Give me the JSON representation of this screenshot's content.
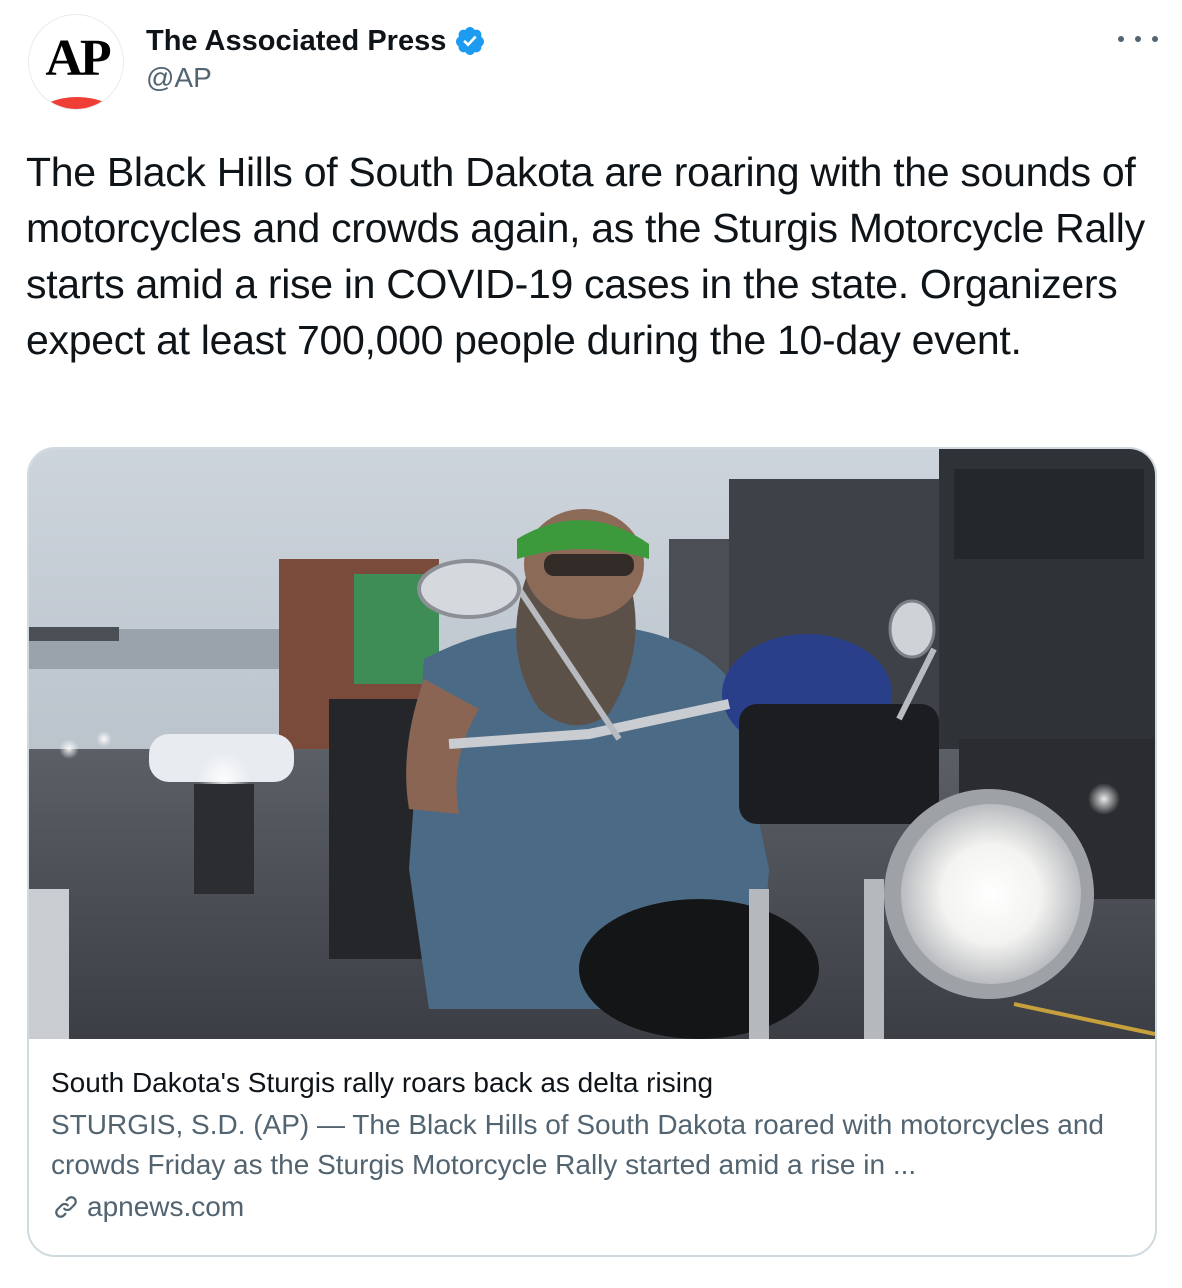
{
  "author": {
    "display_name": "The Associated Press",
    "handle": "@AP",
    "avatar_text": "AP",
    "verified": true
  },
  "more_icon": "more-horizontal-icon",
  "tweet": {
    "text": "The Black Hills of South Dakota are roaring with the sounds of motorcycles and crowds again, as the Sturgis Motorcycle Rally starts amid a rise in COVID-19 cases in the state. Organizers expect at least 700,000 people during the 10-day event."
  },
  "card": {
    "title": "South Dakota's Sturgis rally roars back as delta rising",
    "description": "STURGIS, S.D. (AP) — The Black Hills of South Dakota roared with motorcycles and crowds Friday as the Sturgis Motorcycle Rally started amid a rise in ...",
    "domain": "apnews.com",
    "link_icon": "link-icon"
  },
  "colors": {
    "verified_blue": "#1d9bf0",
    "ap_red": "#ef3e36",
    "secondary_text": "#536471",
    "border": "#cfd9de"
  }
}
